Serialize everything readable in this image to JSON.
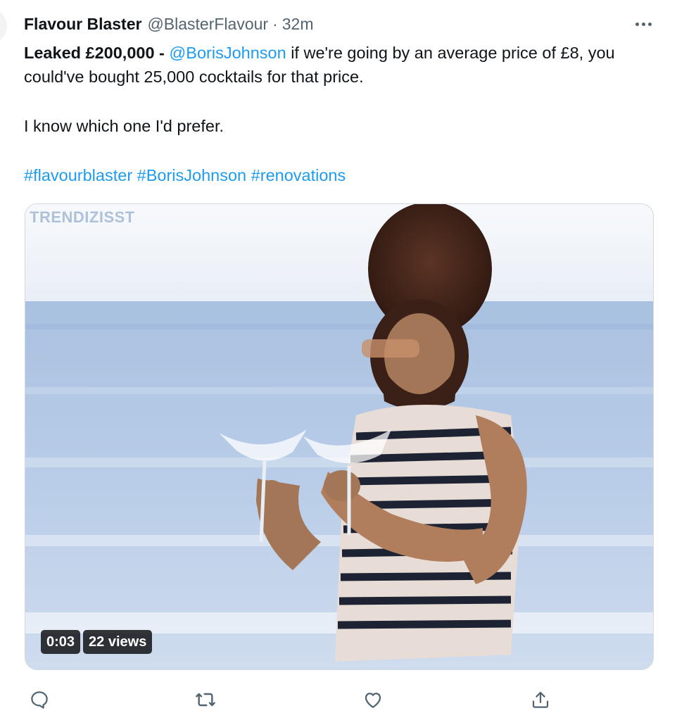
{
  "tweet": {
    "display_name": "Flavour Blaster",
    "handle": "@BlasterFlavour",
    "separator": "·",
    "time": "32m",
    "body": {
      "lead": "Leaked £200,000 - ",
      "mention": "@BorisJohnson",
      "rest": " if we're going by an average price of £8, you could've bought 25,000 cocktails for that price.",
      "second": "I know which one I'd prefer.",
      "hashtags": [
        "#flavourblaster",
        "#BorisJohnson",
        "#renovations"
      ]
    },
    "media": {
      "watermark": "TRENDIZISST",
      "duration": "0:03",
      "views": "22 views"
    },
    "icons": {
      "more": "more-dots-icon",
      "reply": "reply-icon",
      "retweet": "retweet-icon",
      "like": "like-icon",
      "share": "share-icon"
    },
    "colors": {
      "link": "#1d9bf0",
      "text": "#0f1419",
      "secondary": "#536471"
    }
  }
}
